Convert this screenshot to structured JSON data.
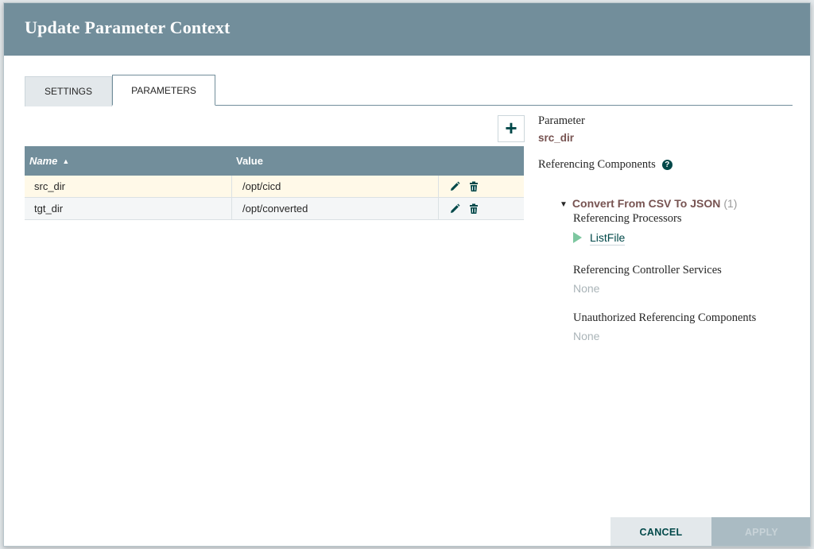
{
  "dialog": {
    "title": "Update Parameter Context"
  },
  "tabs": [
    {
      "label": "SETTINGS",
      "active": false
    },
    {
      "label": "PARAMETERS",
      "active": true
    }
  ],
  "toolbar": {
    "add_symbol": "+"
  },
  "table": {
    "columns": [
      {
        "label": "Name",
        "sort": "▲"
      },
      {
        "label": "Value"
      }
    ],
    "rows": [
      {
        "name": "src_dir",
        "value": "/opt/cicd",
        "selected": true
      },
      {
        "name": "tgt_dir",
        "value": "/opt/converted",
        "selected": false
      }
    ]
  },
  "details": {
    "parameter_label": "Parameter",
    "parameter_name": "src_dir",
    "referencing_label": "Referencing Components",
    "help_symbol": "?",
    "group": {
      "name": "Convert From CSV To JSON",
      "count": "(1)"
    },
    "processors_label": "Referencing Processors",
    "processor_name": "ListFile",
    "controller_services_label": "Referencing Controller Services",
    "controller_services_value": "None",
    "unauthorized_label": "Unauthorized Referencing Components",
    "unauthorized_value": "None"
  },
  "footer": {
    "cancel_label": "CANCEL",
    "apply_label": "APPLY"
  },
  "colors": {
    "header": "#728e9b",
    "accent": "#004849",
    "parameter_text": "#775351",
    "selected_row": "#fff9e8",
    "running_status": "#7dc7a0"
  },
  "icons": [
    "pencil-icon",
    "trash-icon",
    "plus-icon",
    "help-icon",
    "play-icon",
    "caret-down-icon",
    "sort-asc-icon"
  ]
}
